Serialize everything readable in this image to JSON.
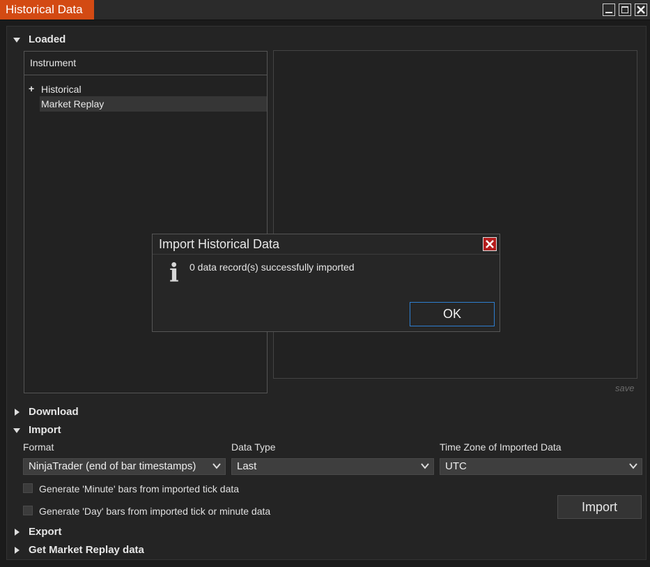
{
  "window": {
    "title": "Historical Data"
  },
  "sections": {
    "loaded": "Loaded",
    "download": "Download",
    "import": "Import",
    "export": "Export",
    "get_replay": "Get Market Replay data"
  },
  "tree": {
    "header": "Instrument",
    "items": [
      "Historical",
      "Market Replay"
    ],
    "expand_symbol": "+"
  },
  "save_label": "save",
  "import_section": {
    "format_label": "Format",
    "format_value": "NinjaTrader (end of bar timestamps)",
    "data_type_label": "Data Type",
    "data_type_value": "Last",
    "timezone_label": "Time Zone of Imported Data",
    "timezone_value": "UTC",
    "check_minute": "Generate 'Minute' bars from imported tick data",
    "check_day": "Generate 'Day' bars from imported tick or minute data",
    "import_button": "Import"
  },
  "dialog": {
    "title": "Import Historical Data",
    "message": "0 data record(s) successfully imported",
    "icon": "i",
    "ok": "OK"
  },
  "colors": {
    "title_accent": "#d34a13",
    "ok_border": "#2e7fd1",
    "close_red": "#b31c1c"
  }
}
